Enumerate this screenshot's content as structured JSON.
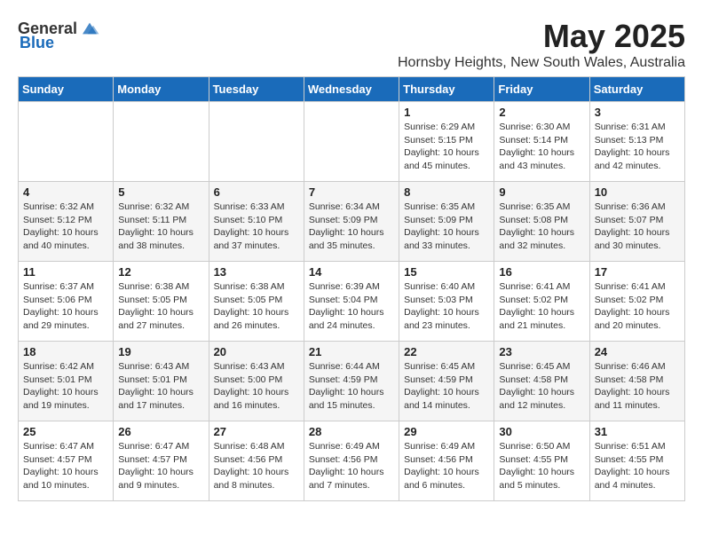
{
  "header": {
    "logo_general": "General",
    "logo_blue": "Blue",
    "month": "May 2025",
    "location": "Hornsby Heights, New South Wales, Australia"
  },
  "days_of_week": [
    "Sunday",
    "Monday",
    "Tuesday",
    "Wednesday",
    "Thursday",
    "Friday",
    "Saturday"
  ],
  "weeks": [
    [
      {
        "day": "",
        "info": ""
      },
      {
        "day": "",
        "info": ""
      },
      {
        "day": "",
        "info": ""
      },
      {
        "day": "",
        "info": ""
      },
      {
        "day": "1",
        "info": "Sunrise: 6:29 AM\nSunset: 5:15 PM\nDaylight: 10 hours\nand 45 minutes."
      },
      {
        "day": "2",
        "info": "Sunrise: 6:30 AM\nSunset: 5:14 PM\nDaylight: 10 hours\nand 43 minutes."
      },
      {
        "day": "3",
        "info": "Sunrise: 6:31 AM\nSunset: 5:13 PM\nDaylight: 10 hours\nand 42 minutes."
      }
    ],
    [
      {
        "day": "4",
        "info": "Sunrise: 6:32 AM\nSunset: 5:12 PM\nDaylight: 10 hours\nand 40 minutes."
      },
      {
        "day": "5",
        "info": "Sunrise: 6:32 AM\nSunset: 5:11 PM\nDaylight: 10 hours\nand 38 minutes."
      },
      {
        "day": "6",
        "info": "Sunrise: 6:33 AM\nSunset: 5:10 PM\nDaylight: 10 hours\nand 37 minutes."
      },
      {
        "day": "7",
        "info": "Sunrise: 6:34 AM\nSunset: 5:09 PM\nDaylight: 10 hours\nand 35 minutes."
      },
      {
        "day": "8",
        "info": "Sunrise: 6:35 AM\nSunset: 5:09 PM\nDaylight: 10 hours\nand 33 minutes."
      },
      {
        "day": "9",
        "info": "Sunrise: 6:35 AM\nSunset: 5:08 PM\nDaylight: 10 hours\nand 32 minutes."
      },
      {
        "day": "10",
        "info": "Sunrise: 6:36 AM\nSunset: 5:07 PM\nDaylight: 10 hours\nand 30 minutes."
      }
    ],
    [
      {
        "day": "11",
        "info": "Sunrise: 6:37 AM\nSunset: 5:06 PM\nDaylight: 10 hours\nand 29 minutes."
      },
      {
        "day": "12",
        "info": "Sunrise: 6:38 AM\nSunset: 5:05 PM\nDaylight: 10 hours\nand 27 minutes."
      },
      {
        "day": "13",
        "info": "Sunrise: 6:38 AM\nSunset: 5:05 PM\nDaylight: 10 hours\nand 26 minutes."
      },
      {
        "day": "14",
        "info": "Sunrise: 6:39 AM\nSunset: 5:04 PM\nDaylight: 10 hours\nand 24 minutes."
      },
      {
        "day": "15",
        "info": "Sunrise: 6:40 AM\nSunset: 5:03 PM\nDaylight: 10 hours\nand 23 minutes."
      },
      {
        "day": "16",
        "info": "Sunrise: 6:41 AM\nSunset: 5:02 PM\nDaylight: 10 hours\nand 21 minutes."
      },
      {
        "day": "17",
        "info": "Sunrise: 6:41 AM\nSunset: 5:02 PM\nDaylight: 10 hours\nand 20 minutes."
      }
    ],
    [
      {
        "day": "18",
        "info": "Sunrise: 6:42 AM\nSunset: 5:01 PM\nDaylight: 10 hours\nand 19 minutes."
      },
      {
        "day": "19",
        "info": "Sunrise: 6:43 AM\nSunset: 5:01 PM\nDaylight: 10 hours\nand 17 minutes."
      },
      {
        "day": "20",
        "info": "Sunrise: 6:43 AM\nSunset: 5:00 PM\nDaylight: 10 hours\nand 16 minutes."
      },
      {
        "day": "21",
        "info": "Sunrise: 6:44 AM\nSunset: 4:59 PM\nDaylight: 10 hours\nand 15 minutes."
      },
      {
        "day": "22",
        "info": "Sunrise: 6:45 AM\nSunset: 4:59 PM\nDaylight: 10 hours\nand 14 minutes."
      },
      {
        "day": "23",
        "info": "Sunrise: 6:45 AM\nSunset: 4:58 PM\nDaylight: 10 hours\nand 12 minutes."
      },
      {
        "day": "24",
        "info": "Sunrise: 6:46 AM\nSunset: 4:58 PM\nDaylight: 10 hours\nand 11 minutes."
      }
    ],
    [
      {
        "day": "25",
        "info": "Sunrise: 6:47 AM\nSunset: 4:57 PM\nDaylight: 10 hours\nand 10 minutes."
      },
      {
        "day": "26",
        "info": "Sunrise: 6:47 AM\nSunset: 4:57 PM\nDaylight: 10 hours\nand 9 minutes."
      },
      {
        "day": "27",
        "info": "Sunrise: 6:48 AM\nSunset: 4:56 PM\nDaylight: 10 hours\nand 8 minutes."
      },
      {
        "day": "28",
        "info": "Sunrise: 6:49 AM\nSunset: 4:56 PM\nDaylight: 10 hours\nand 7 minutes."
      },
      {
        "day": "29",
        "info": "Sunrise: 6:49 AM\nSunset: 4:56 PM\nDaylight: 10 hours\nand 6 minutes."
      },
      {
        "day": "30",
        "info": "Sunrise: 6:50 AM\nSunset: 4:55 PM\nDaylight: 10 hours\nand 5 minutes."
      },
      {
        "day": "31",
        "info": "Sunrise: 6:51 AM\nSunset: 4:55 PM\nDaylight: 10 hours\nand 4 minutes."
      }
    ]
  ]
}
